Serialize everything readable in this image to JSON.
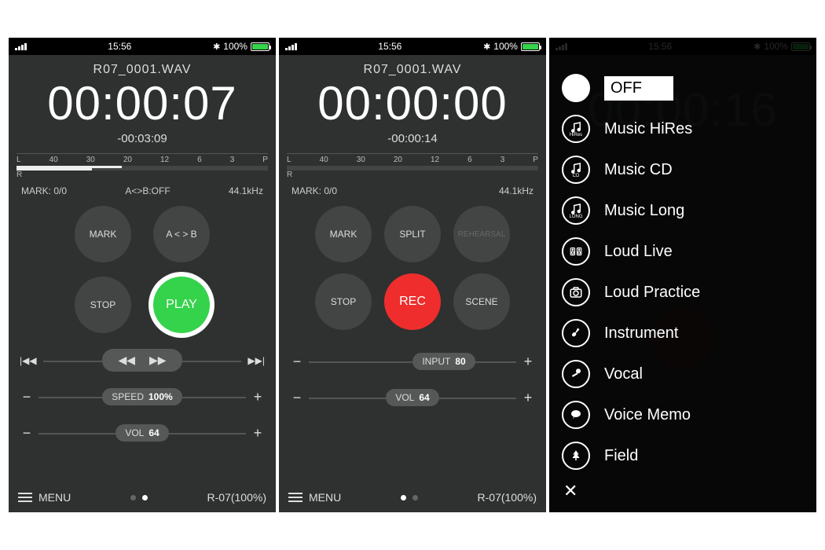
{
  "status": {
    "time": "15:56",
    "battery_pct": "100%",
    "bluetooth": "✱"
  },
  "play": {
    "filename": "R07_0001.WAV",
    "elapsed": "00:00:07",
    "remaining": "-00:03:09",
    "meter_ticks": [
      "L",
      "40",
      "30",
      "20",
      "12",
      "6",
      "3",
      "P"
    ],
    "meter_L_fill_pct": 42,
    "meter_L_fill2_pct": 30,
    "meter_R_label": "R",
    "mark": "MARK: 0/0",
    "ab": "A<>B:OFF",
    "rate": "44.1kHz",
    "btn_mark": "MARK",
    "btn_ab": "A < > B",
    "btn_stop": "STOP",
    "btn_play": "PLAY",
    "speed_label": "SPEED",
    "speed_value": "100%",
    "vol_label": "VOL",
    "vol_value": "64",
    "menu_label": "MENU",
    "device": "R-07(100%)"
  },
  "rec": {
    "filename": "R07_0001.WAV",
    "elapsed": "00:00:00",
    "remaining": "-00:00:14",
    "meter_ticks": [
      "L",
      "40",
      "30",
      "20",
      "12",
      "6",
      "3",
      "P"
    ],
    "meter_R_label": "R",
    "mark": "MARK: 0/0",
    "rate": "44.1kHz",
    "btn_mark": "MARK",
    "btn_split": "SPLIT",
    "btn_rehearsal": "REHEARSAL",
    "btn_stop": "STOP",
    "btn_rec": "REC",
    "btn_scene": "SCENE",
    "input_label": "INPUT",
    "input_value": "80",
    "vol_label": "VOL",
    "vol_value": "64",
    "menu_label": "MENU",
    "device": "R-07(100%)"
  },
  "scene": {
    "items": [
      {
        "label": "OFF",
        "icon": "blank",
        "selected": true
      },
      {
        "label": "Music HiRes",
        "icon": "music-hires"
      },
      {
        "label": "Music CD",
        "icon": "music-cd"
      },
      {
        "label": "Music Long",
        "icon": "music-long"
      },
      {
        "label": "Loud Live",
        "icon": "speakers"
      },
      {
        "label": "Loud Practice",
        "icon": "camera"
      },
      {
        "label": "Instrument",
        "icon": "guitar"
      },
      {
        "label": "Vocal",
        "icon": "mic"
      },
      {
        "label": "Voice Memo",
        "icon": "speech"
      },
      {
        "label": "Field",
        "icon": "tree"
      }
    ],
    "close": "✕"
  }
}
